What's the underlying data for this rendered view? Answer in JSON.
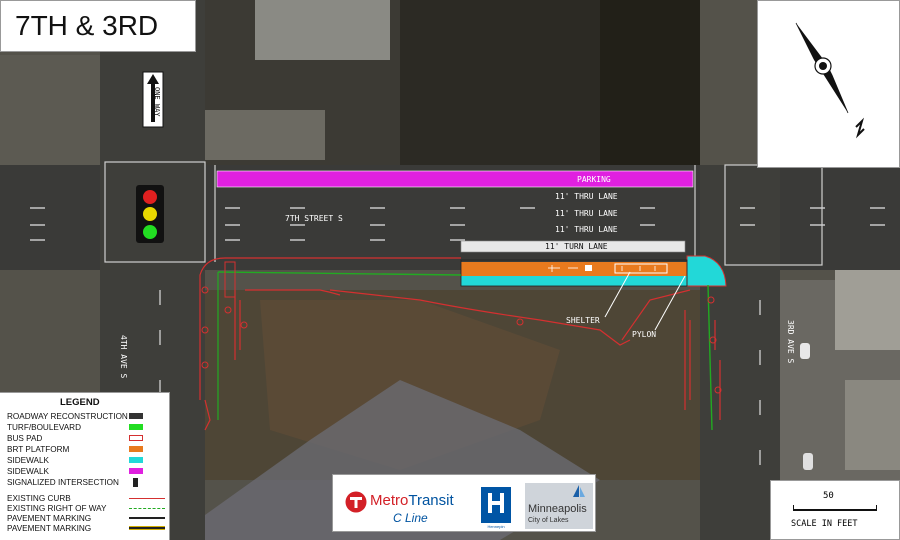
{
  "title": "7TH & 3RD",
  "labels": {
    "parking": "PARKING",
    "thru_lane_1": "11' THRU LANE",
    "thru_lane_2": "11' THRU LANE",
    "thru_lane_3": "11' THRU LANE",
    "turn_lane": "11' TURN LANE",
    "street": "7TH STREET S",
    "shelter": "SHELTER",
    "pylon": "PYLON",
    "ave_4th": "4TH AVE S",
    "ave_3rd": "3RD AVE S",
    "one_way": "ONE WAY"
  },
  "legend": {
    "title": "LEGEND",
    "items": [
      {
        "label": "ROADWAY RECONSTRUCTION",
        "color": "#333333",
        "style": "fill"
      },
      {
        "label": "TURF/BOULEVARD",
        "color": "#22dd22",
        "style": "fill"
      },
      {
        "label": "BUS PAD",
        "color": "#ffffff",
        "style": "outline-red"
      },
      {
        "label": "BRT PLATFORM",
        "color": "#e87a1e",
        "style": "fill"
      },
      {
        "label": "SIDEWALK",
        "color": "#22d8d8",
        "style": "fill"
      },
      {
        "label": "SIDEWALK",
        "color": "#e020e0",
        "style": "fill"
      },
      {
        "label": "SIGNALIZED INTERSECTION",
        "color": "#222222",
        "style": "signal"
      },
      {
        "label": "EXISTING CURB",
        "color": "#d43030",
        "style": "line"
      },
      {
        "label": "EXISTING RIGHT OF WAY",
        "color": "#22aa22",
        "style": "dash"
      },
      {
        "label": "PAVEMENT MARKING",
        "color": "#222222",
        "style": "line"
      },
      {
        "label": "PAVEMENT MARKING",
        "color": "#d4b000",
        "style": "double"
      }
    ]
  },
  "logos": {
    "metro_a": "Metro",
    "metro_b": "Transit",
    "c_line": "C Line",
    "hennepin": "Hennepin",
    "minneapolis": "Minneapolis",
    "minneapolis_sub": "City of Lakes"
  },
  "scale": {
    "value": "50",
    "label": "SCALE IN FEET"
  },
  "colors": {
    "parking": "#e020e0",
    "platform": "#e87a1e",
    "sidewalk": "#22d8d8",
    "turn_lane": "#e8e8e8",
    "curb": "#d43030",
    "row": "#22aa22"
  }
}
